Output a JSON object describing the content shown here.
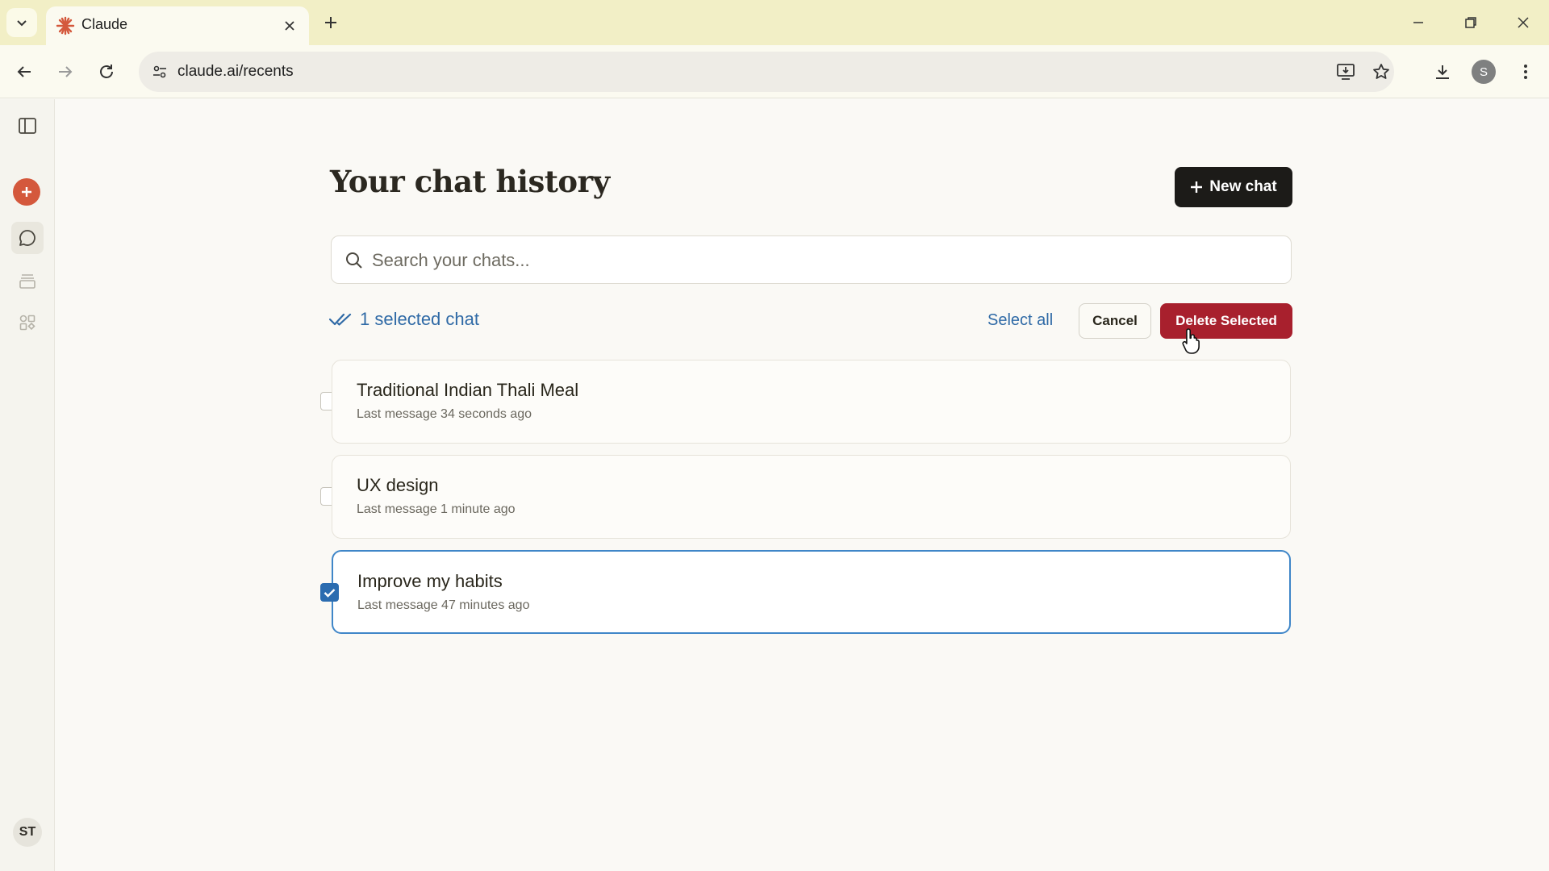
{
  "browser": {
    "tab_title": "Claude",
    "url": "claude.ai/recents",
    "profile_initial": "S"
  },
  "sidebar": {
    "user_initials": "ST"
  },
  "main": {
    "page_title": "Your chat history",
    "new_chat_label": "New chat",
    "search_placeholder": "Search your chats...",
    "search_value": "",
    "selected_count_label": "1 selected chat",
    "select_all_label": "Select all",
    "cancel_label": "Cancel",
    "delete_label": "Delete Selected",
    "chats": [
      {
        "title": "Traditional Indian Thali Meal",
        "meta": "Last message 34 seconds ago",
        "checked": false
      },
      {
        "title": "UX design",
        "meta": "Last message 1 minute ago",
        "checked": false
      },
      {
        "title": "Improve my habits",
        "meta": "Last message 47 minutes ago",
        "checked": true
      }
    ]
  },
  "colors": {
    "accent_blue": "#2f6aa6",
    "delete_red": "#a8202d",
    "claude_orange": "#d4583c"
  }
}
